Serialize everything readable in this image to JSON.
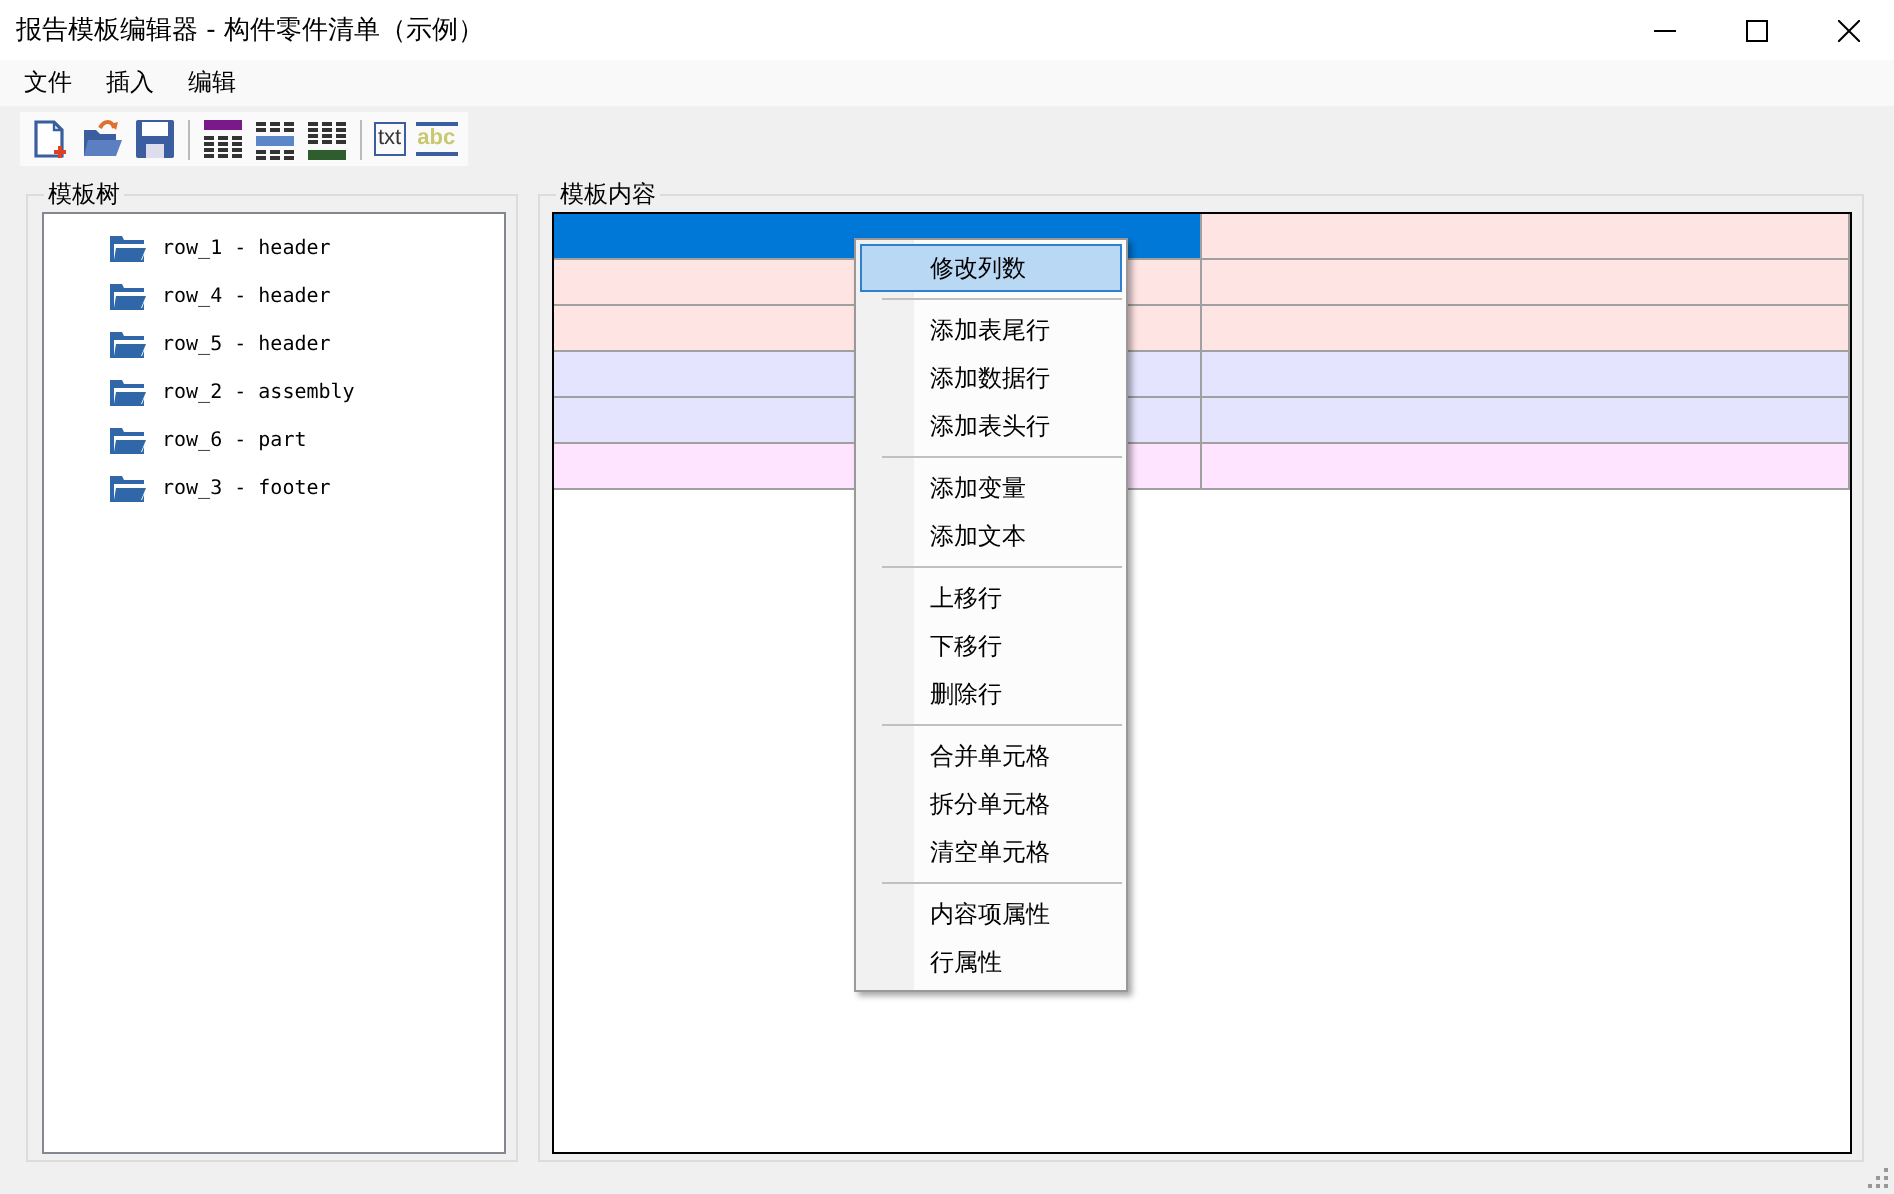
{
  "window": {
    "title": "报告模板编辑器 - 构件零件清单（示例）"
  },
  "menu_bar": [
    "文件",
    "插入",
    "编辑"
  ],
  "toolbar": [
    {
      "kind": "new"
    },
    {
      "kind": "open"
    },
    {
      "kind": "save"
    },
    {
      "kind": "separator"
    },
    {
      "kind": "table-header"
    },
    {
      "kind": "table-data"
    },
    {
      "kind": "table-footer"
    },
    {
      "kind": "separator"
    },
    {
      "kind": "text",
      "text": "txt"
    },
    {
      "kind": "variable",
      "text": "abc"
    }
  ],
  "tree": {
    "title": "模板树",
    "items": [
      {
        "label": "row_1 - header"
      },
      {
        "label": "row_4 - header"
      },
      {
        "label": "row_5 - header"
      },
      {
        "label": "row_2 - assembly"
      },
      {
        "label": "row_6 - part"
      },
      {
        "label": "row_3 - footer"
      }
    ]
  },
  "content": {
    "title": "模板内容",
    "rows": [
      {
        "color": "#ffe4e4",
        "cells": [
          {
            "selected": true
          },
          {
            "selected": false
          }
        ]
      },
      {
        "color": "#ffe4e4",
        "cells": [
          {
            "selected": false
          },
          {
            "selected": false
          }
        ]
      },
      {
        "color": "#ffe4e4",
        "cells": [
          {
            "selected": false
          },
          {
            "selected": false
          }
        ]
      },
      {
        "color": "#e4e4ff",
        "cells": [
          {
            "selected": false
          },
          {
            "selected": false
          }
        ]
      },
      {
        "color": "#e4e4ff",
        "cells": [
          {
            "selected": false
          },
          {
            "selected": false
          }
        ]
      },
      {
        "color": "#ffe4ff",
        "cells": [
          {
            "selected": false
          },
          {
            "selected": false
          }
        ]
      }
    ]
  },
  "context_menu": {
    "groups": [
      [
        {
          "label": "修改列数",
          "selected": true
        }
      ],
      [
        {
          "label": "添加表尾行",
          "selected": false
        },
        {
          "label": "添加数据行",
          "selected": false
        },
        {
          "label": "添加表头行",
          "selected": false
        }
      ],
      [
        {
          "label": "添加变量",
          "selected": false
        },
        {
          "label": "添加文本",
          "selected": false
        }
      ],
      [
        {
          "label": "上移行",
          "selected": false
        },
        {
          "label": "下移行",
          "selected": false
        },
        {
          "label": "删除行",
          "selected": false
        }
      ],
      [
        {
          "label": "合并单元格",
          "selected": false
        },
        {
          "label": "拆分单元格",
          "selected": false
        },
        {
          "label": "清空单元格",
          "selected": false
        }
      ],
      [
        {
          "label": "内容项属性",
          "selected": false
        },
        {
          "label": "行属性",
          "selected": false
        }
      ]
    ]
  }
}
